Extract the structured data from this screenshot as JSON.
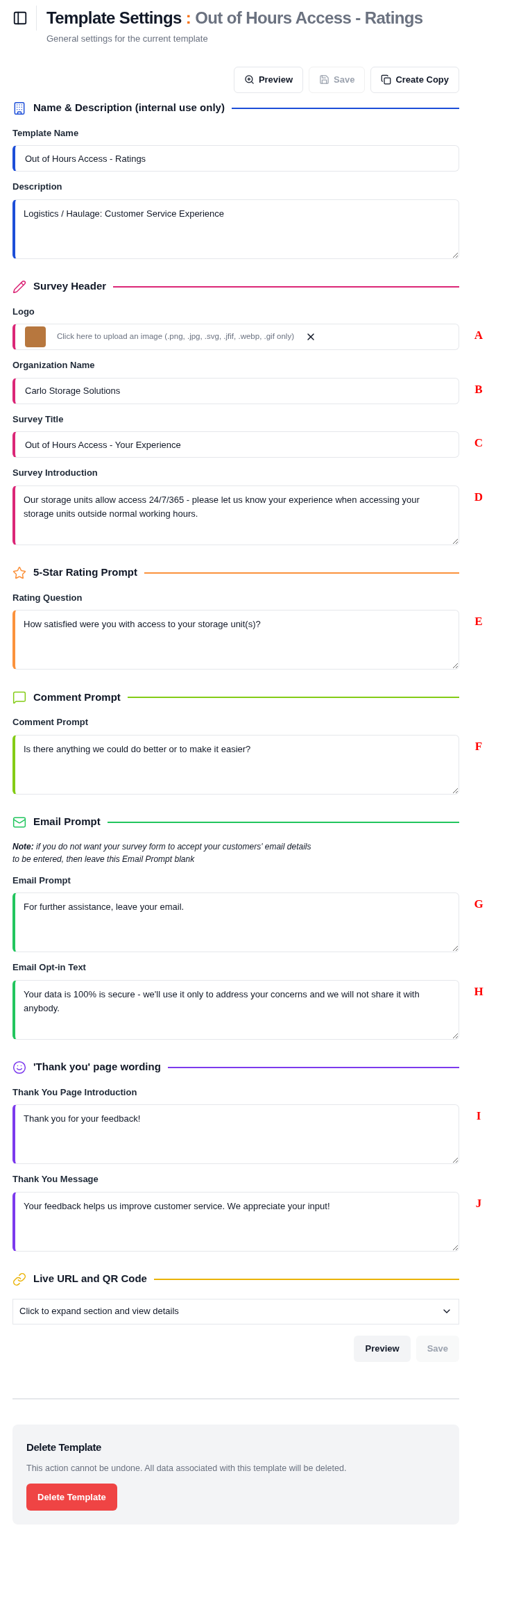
{
  "header": {
    "title": "Template Settings",
    "separator": ":",
    "template_name": "Out of Hours Access - Ratings",
    "subtitle": "General settings for the current template"
  },
  "top_actions": [
    {
      "label": "Preview",
      "disabled": false
    },
    {
      "label": "Save",
      "disabled": true
    },
    {
      "label": "Create Copy",
      "disabled": false
    }
  ],
  "sections": [
    {
      "title": "Name & Description (internal use only)",
      "color": "#1d4ed8",
      "fields": [
        {
          "kind": "input",
          "label": "Template Name",
          "value": "Out of Hours Access - Ratings"
        },
        {
          "kind": "textarea",
          "label": "Description",
          "value": "Logistics / Haulage: Customer Service Experience"
        }
      ]
    },
    {
      "title": "Survey Header",
      "color": "#db2777",
      "fields": [
        {
          "kind": "logo",
          "label": "Logo",
          "placeholder": "Click here to upload an image (.png, .jpg, .svg, .jfif, .webp, .gif only)",
          "marker": "A"
        },
        {
          "kind": "input",
          "label": "Organization Name",
          "value": "Carlo Storage Solutions",
          "marker": "B"
        },
        {
          "kind": "input",
          "label": "Survey Title",
          "value": "Out of Hours Access - Your Experience",
          "marker": "C"
        },
        {
          "kind": "textarea",
          "label": "Survey Introduction",
          "value": "Our storage units allow access 24/7/365 - please let us know your experience when accessing your storage units outside normal working hours.",
          "marker": "D"
        }
      ]
    },
    {
      "title": "5-Star Rating Prompt",
      "color": "#fb923c",
      "fields": [
        {
          "kind": "textarea",
          "label": "Rating Question",
          "value": "How satisfied were you with access to your storage unit(s)?",
          "marker": "E"
        }
      ]
    },
    {
      "title": "Comment Prompt",
      "color": "#84cc16",
      "fields": [
        {
          "kind": "textarea",
          "label": "Comment Prompt",
          "value": "Is there anything we could do better or to make it easier?",
          "marker": "F"
        }
      ]
    },
    {
      "title": "Email Prompt",
      "color": "#22c55e",
      "note": "**Note:** if you do not want your survey form to accept your customers' email details to be entered, then leave this Email Prompt blank",
      "fields": [
        {
          "kind": "textarea",
          "label": "Email Prompt",
          "value": "For further assistance, leave your email.",
          "marker": "G"
        },
        {
          "kind": "textarea",
          "label": "Email Opt-in Text",
          "value": "Your data is 100% is secure - we'll use it only to address your concerns and we will not share it with anybody.",
          "marker": "H"
        }
      ]
    },
    {
      "title": "'Thank you' page wording",
      "color": "#7c3aed",
      "fields": [
        {
          "kind": "textarea",
          "label": "Thank You Page Introduction",
          "value": "Thank you for your feedback!",
          "marker": "I"
        },
        {
          "kind": "textarea",
          "label": "Thank You Message",
          "value": "Your feedback helps us improve customer service. We appreciate your input!",
          "marker": "J"
        }
      ]
    },
    {
      "title": "Live URL and QR Code",
      "color": "#eab308",
      "collapsible": {
        "text": "Click to expand section and view details",
        "expanded": false
      }
    }
  ],
  "bottom_actions": [
    {
      "label": "Preview",
      "disabled": false
    },
    {
      "label": "Save",
      "disabled": true
    }
  ],
  "danger_zone": {
    "title": "Delete Template",
    "text": "This action cannot be undone. All data associated with this template will be deleted.",
    "button": "Delete Template"
  }
}
